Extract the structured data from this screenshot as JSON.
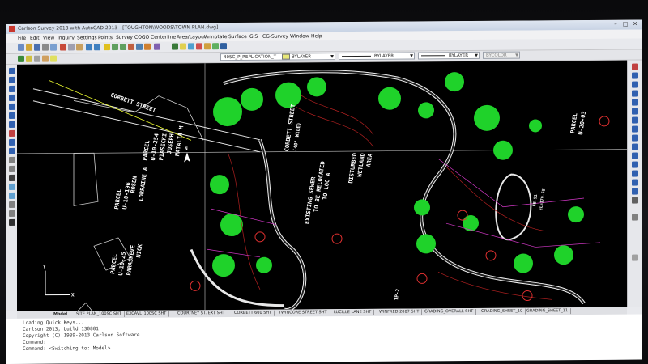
{
  "window": {
    "title": "Carlson Survey 2013 with AutoCAD 2013 - [TOUGHTON\\WOODS\\TOWN PLAN.dwg]",
    "minimize": "–",
    "maximize": "□",
    "close": "✕"
  },
  "menu": [
    "File",
    "Edit",
    "View",
    "Inquiry",
    "Settings",
    "Points",
    "Survey",
    "COGO",
    "Centerline",
    "Area/Layout",
    "Annotate",
    "Surface",
    "GIS",
    "CG-Survey",
    "Window",
    "Help"
  ],
  "toolbar": {
    "layer_value": "405C_P_REPLICATION_T",
    "color_value": "BYLAYER",
    "linetype_value": "BYLAYER",
    "lineweight_value": "BYLAYER",
    "plotstyle_value": "BYCOLOR"
  },
  "drawing": {
    "labels": {
      "corbett_street_top": "CORBETT STREET",
      "corbett_street_mid": "CORBETT STREET",
      "width_40": "(40' WIDE)",
      "existing_sewer": "EXISTING SEWER",
      "to_be_relocated": "TO BE RELOCATED",
      "to_loc_a": "TO LOC A",
      "disturbed": "DISTURBED",
      "wetland": "WETLAND",
      "area": "AREA",
      "parcel_left": "PARCEL",
      "parcel_left_id": "U-10-196",
      "parcel_mid": "PARCEL",
      "parcel_mid_id": "U-10-25",
      "parcel_top": "PARCEL",
      "parcel_top_id": "U-10-254",
      "parcel_right": "PARCEL",
      "parcel_right_id": "U-20-03",
      "owner_1": "PIASECKI",
      "owner_2": "JOSEPH",
      "owner_3": "NATALIA M",
      "owner_4": "ROSEN",
      "owner_5": "LORRAINE A",
      "owner_6": "PARASKEVE",
      "owner_7": "NICK",
      "tp_label": "TP-2",
      "fb_label": "FB-51",
      "elev": "EL=179.55",
      "north_arrow": "N",
      "axis_x": "X",
      "axis_y": "Y"
    }
  },
  "tabs": [
    "Model",
    "SITE PLAN_100SC SHT",
    "EXCAVL_100SC SHT",
    "COURTNEY ST. EXT SHT",
    "CORBETT 600 SHT",
    "TWINCORE STREET SHT",
    "LUCILLE LANE SHT",
    "WINFRED 2007 SHT",
    "GRADING_OVERALL SHT",
    "GRADING_SHEET_10",
    "GRADING_SHEET_11"
  ],
  "command": {
    "lines": [
      "Loading Quick Keys...",
      "Carlson 2013, build 130801",
      "Copyright (C) 1989-2013 Carlson Software.",
      "Command:",
      "Command: <Switching to: Model>"
    ]
  },
  "colors": {
    "drawing_bg": "#000000",
    "vegetation": "#1fd22a",
    "roads": "#e8e8e8",
    "property": "#d438c8",
    "contour": "#b02020",
    "highlight": "#f0ff30"
  }
}
